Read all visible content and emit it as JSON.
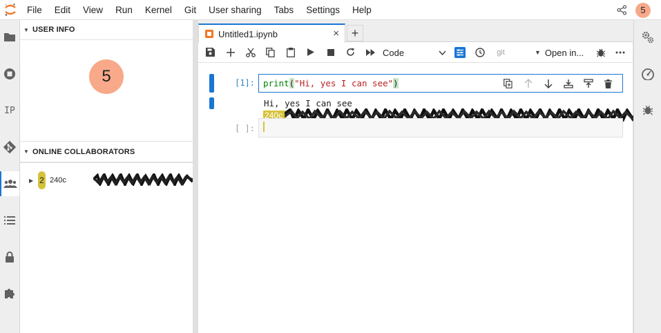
{
  "menubar": {
    "logo_icon": "jupyter-logo-icon",
    "items": [
      "File",
      "Edit",
      "View",
      "Run",
      "Kernel",
      "Git",
      "User sharing",
      "Tabs",
      "Settings",
      "Help"
    ],
    "share_icon": "share-icon",
    "avatar_initial": "5",
    "avatar_color": "#f7a98a"
  },
  "left_bar": {
    "icons": [
      "folder-icon",
      "running-sessions-icon",
      "ip-icon",
      "git-icon",
      "collaborators-icon",
      "table-of-contents-icon",
      "lock-icon",
      "extensions-icon"
    ],
    "ip_text": "IP",
    "accent": "#1976d2"
  },
  "side_panel": {
    "user_info": {
      "title": "USER INFO",
      "avatar_initial": "5"
    },
    "collaborators": {
      "title": "ONLINE COLLABORATORS",
      "items": [
        {
          "badge": "2",
          "name": "240c",
          "badge_color": "#d5c23b"
        }
      ]
    }
  },
  "notebook": {
    "tab": {
      "title": "Untitled1.ipynb",
      "close": "×"
    },
    "add_tab": "+",
    "toolbar": {
      "cell_type": "Code",
      "git_label": "git",
      "open_in": "Open in..."
    },
    "cells": [
      {
        "prompt": "[1]:",
        "code_fn": "print",
        "code_open": "(",
        "code_str": "\"Hi, yes I can see\"",
        "code_close": ")",
        "output": "Hi, yes I can see"
      },
      {
        "prompt": "[ ]:",
        "cursor_label": "240c"
      }
    ]
  },
  "right_bar": {
    "icons": [
      "property-inspector-icon",
      "kernel-usage-icon",
      "debugger-icon"
    ]
  }
}
